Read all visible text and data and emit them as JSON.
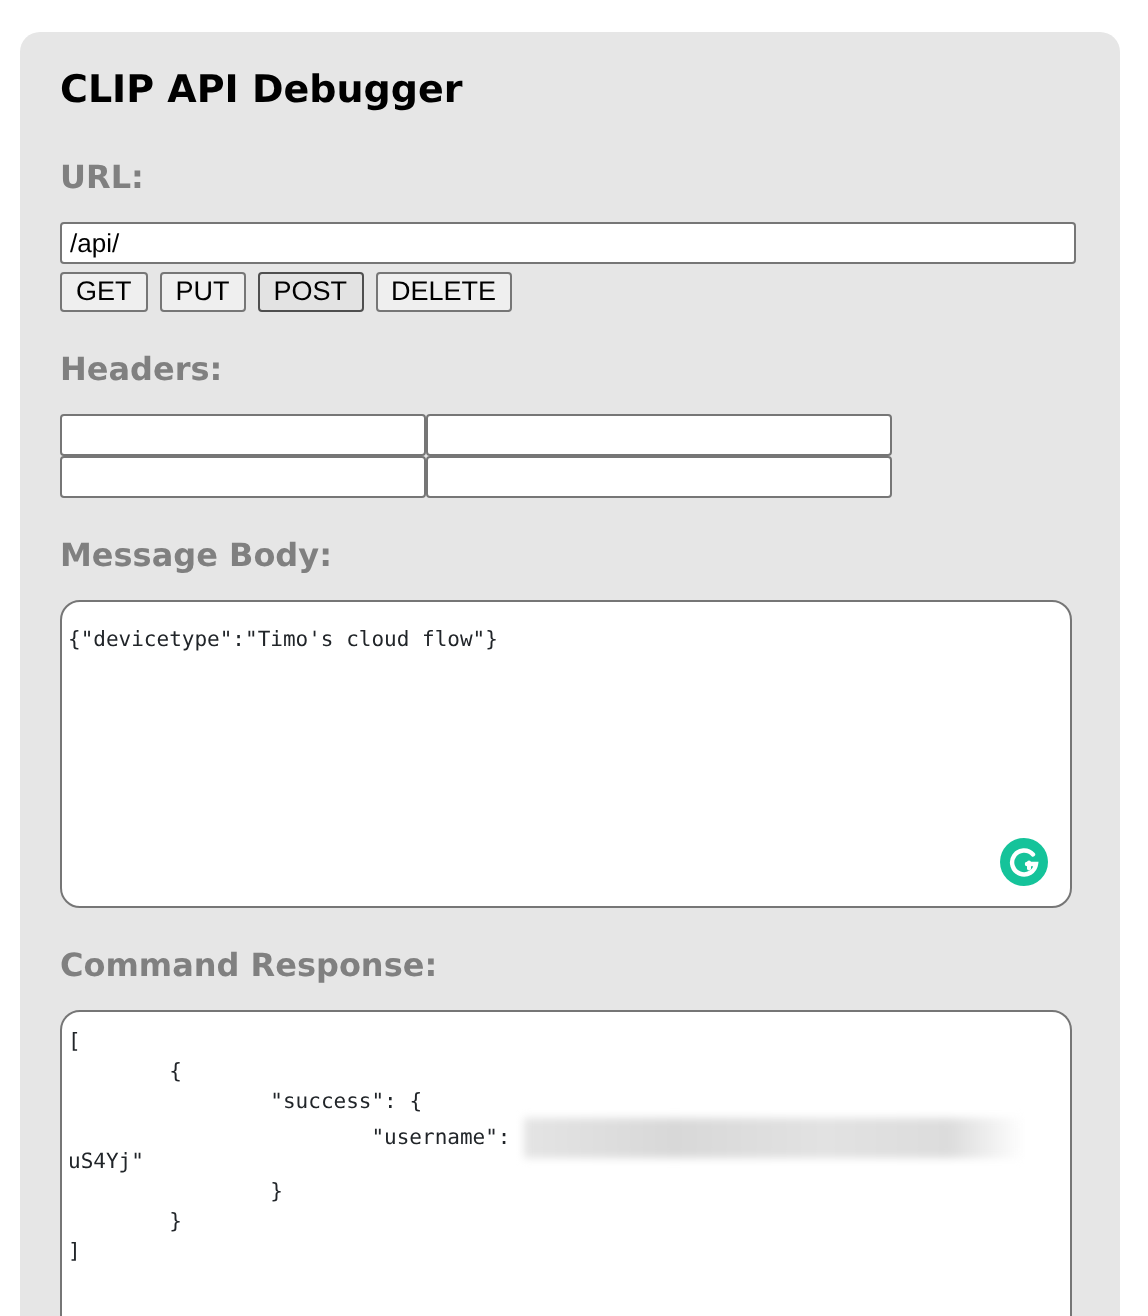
{
  "title": "CLIP API Debugger",
  "url": {
    "label": "URL:",
    "value": "/api/"
  },
  "methods": [
    {
      "label": "GET",
      "selected": false
    },
    {
      "label": "PUT",
      "selected": false
    },
    {
      "label": "POST",
      "selected": true
    },
    {
      "label": "DELETE",
      "selected": false
    }
  ],
  "headers": {
    "label": "Headers:"
  },
  "message_body": {
    "label": "Message Body:",
    "value": "{\"devicetype\":\"Timo's cloud flow\"}"
  },
  "response": {
    "label": "Command Response:",
    "lines": [
      {
        "text": "[",
        "redacted": false
      },
      {
        "text": "\t{",
        "redacted": false
      },
      {
        "text": "\t\t\"success\": {",
        "redacted": false
      },
      {
        "text": "\t\t\t\"username\": ",
        "redacted": true
      },
      {
        "text": "uS4Yj\"",
        "redacted": false
      },
      {
        "text": "\t\t}",
        "redacted": false
      },
      {
        "text": "\t}",
        "redacted": false
      },
      {
        "text": "]",
        "redacted": false
      }
    ]
  }
}
